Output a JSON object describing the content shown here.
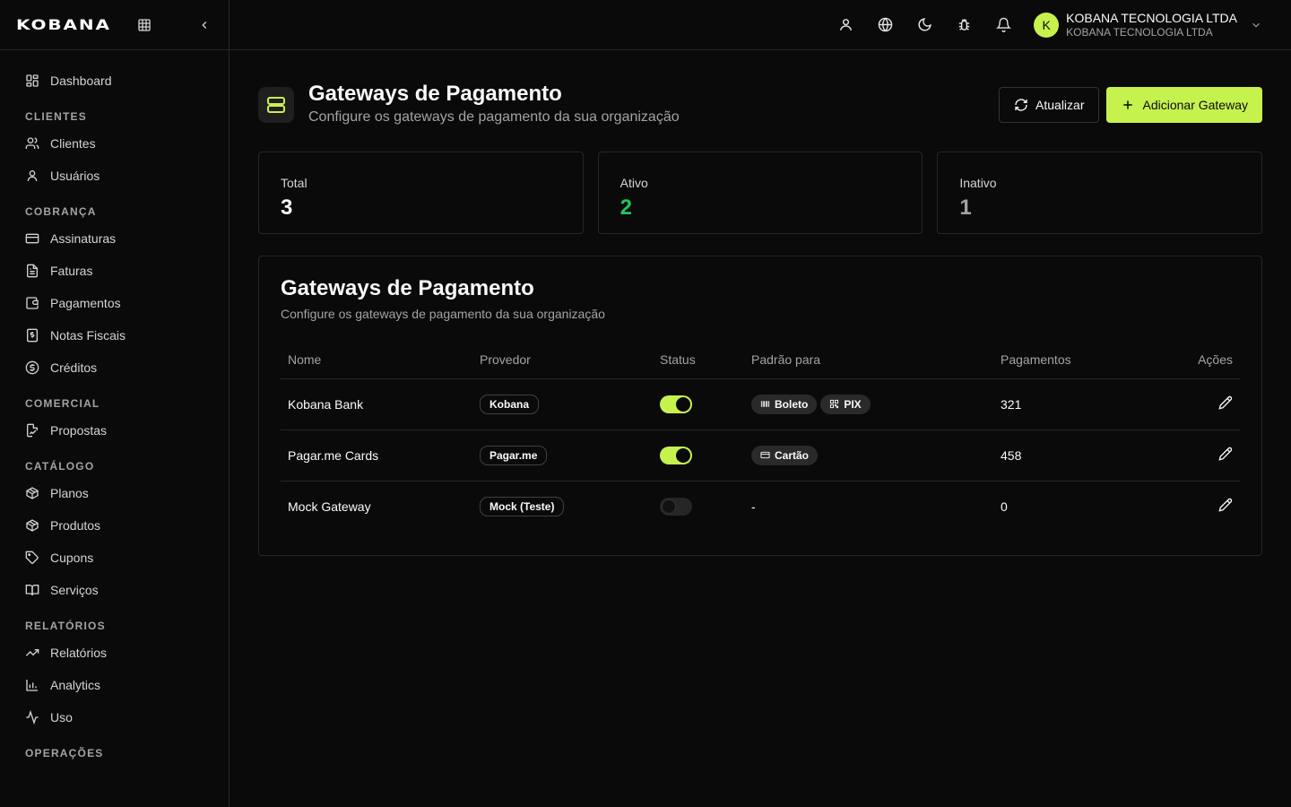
{
  "brand": {
    "logo": "KOBANA",
    "accent": "#c6f24e"
  },
  "sidebar": {
    "dashboard": "Dashboard",
    "sections": [
      {
        "title": "CLIENTES",
        "items": [
          {
            "label": "Clientes",
            "icon": "users-icon"
          },
          {
            "label": "Usuários",
            "icon": "user-icon"
          }
        ]
      },
      {
        "title": "COBRANÇA",
        "items": [
          {
            "label": "Assinaturas",
            "icon": "credit-card-icon"
          },
          {
            "label": "Faturas",
            "icon": "file-text-icon"
          },
          {
            "label": "Pagamentos",
            "icon": "wallet-icon"
          },
          {
            "label": "Notas Fiscais",
            "icon": "receipt-icon"
          },
          {
            "label": "Créditos",
            "icon": "dollar-circle-icon"
          }
        ]
      },
      {
        "title": "COMERCIAL",
        "items": [
          {
            "label": "Propostas",
            "icon": "file-signature-icon"
          }
        ]
      },
      {
        "title": "CATÁLOGO",
        "items": [
          {
            "label": "Planos",
            "icon": "package-icon"
          },
          {
            "label": "Produtos",
            "icon": "package-icon"
          },
          {
            "label": "Cupons",
            "icon": "tag-icon"
          },
          {
            "label": "Serviços",
            "icon": "book-open-icon"
          }
        ]
      },
      {
        "title": "RELATÓRIOS",
        "items": [
          {
            "label": "Relatórios",
            "icon": "trending-up-icon"
          },
          {
            "label": "Analytics",
            "icon": "bar-chart-icon"
          },
          {
            "label": "Uso",
            "icon": "activity-icon"
          }
        ]
      },
      {
        "title": "OPERAÇÕES",
        "items": []
      }
    ]
  },
  "topbar": {
    "org_initial": "K",
    "org_name": "KOBANA TECNOLOGIA LTDA",
    "org_sub": "KOBANA TECNOLOGIA LTDA"
  },
  "page": {
    "title": "Gateways de Pagamento",
    "subtitle": "Configure os gateways de pagamento da sua organização",
    "refresh_label": "Atualizar",
    "add_label": "Adicionar Gateway"
  },
  "stats": {
    "total_label": "Total",
    "total_value": "3",
    "active_label": "Ativo",
    "active_value": "2",
    "active_color": "#22c55e",
    "inactive_label": "Inativo",
    "inactive_value": "1",
    "inactive_color": "#a3a3a3"
  },
  "card": {
    "title": "Gateways de Pagamento",
    "subtitle": "Configure os gateways de pagamento da sua organização",
    "columns": [
      "Nome",
      "Provedor",
      "Status",
      "Padrão para",
      "Pagamentos",
      "Ações"
    ],
    "rows": [
      {
        "name": "Kobana Bank",
        "provider": "Kobana",
        "active": true,
        "defaults": [
          {
            "label": "Boleto",
            "icon": "barcode-icon"
          },
          {
            "label": "PIX",
            "icon": "qr-code-icon"
          }
        ],
        "payments": "321"
      },
      {
        "name": "Pagar.me Cards",
        "provider": "Pagar.me",
        "active": true,
        "defaults": [
          {
            "label": "Cartão",
            "icon": "credit-card-icon"
          }
        ],
        "payments": "458"
      },
      {
        "name": "Mock Gateway",
        "provider": "Mock (Teste)",
        "active": false,
        "defaults": [],
        "defaults_empty": "-",
        "payments": "0"
      }
    ]
  }
}
